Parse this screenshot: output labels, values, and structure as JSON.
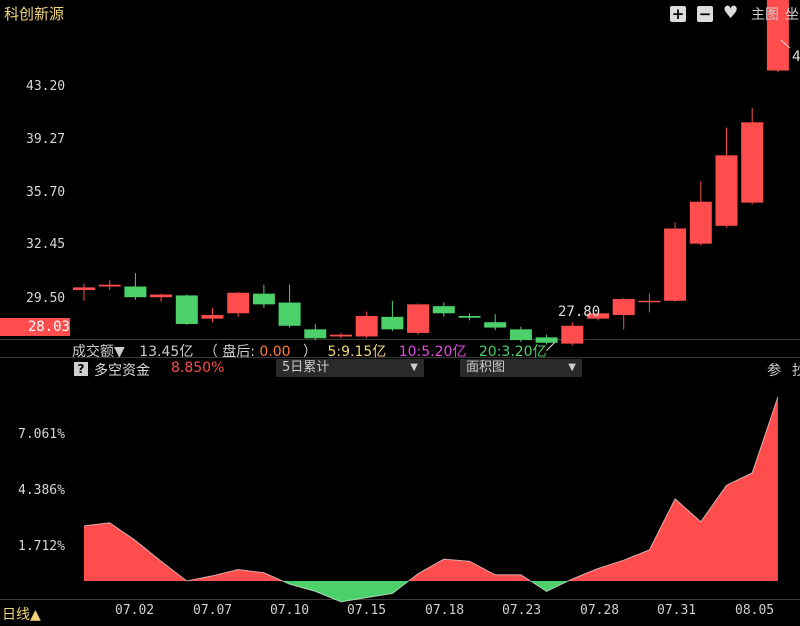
{
  "header": {
    "title": "科创新源",
    "add_icon": "plus-icon",
    "minus_icon": "minus-icon",
    "heart_icon": "heart-icon",
    "main_label": "主图",
    "coord_label": "坐"
  },
  "price_axis": {
    "labels": [
      "43.20",
      "39.27",
      "35.70",
      "32.45",
      "29.50"
    ]
  },
  "current_price": "28.03",
  "annotations": {
    "low_label": "27.80",
    "high_label": "4"
  },
  "volume_row": {
    "label": "成交额▼",
    "value": "13.45亿",
    "paren_open": "（",
    "after_label": "盘后:",
    "after_value": "0.00",
    "paren_close": "）",
    "ma5": "5:9.15亿",
    "ma10": "10:5.20亿",
    "ma20": "20:3.20亿"
  },
  "indicator_row": {
    "help_icon": "?",
    "name": "多空资金",
    "value": "8.850%",
    "period_select": "5日累计",
    "chart_select": "面积图",
    "ref_label": "参",
    "extra_label": "抄"
  },
  "indicator_axis": {
    "labels": [
      "7.061%",
      "4.386%",
      "1.712%"
    ]
  },
  "period_label": "日线▲",
  "x_axis": {
    "labels": [
      "07.02",
      "07.07",
      "07.10",
      "07.15",
      "07.18",
      "07.23",
      "07.28",
      "07.31",
      "08.05"
    ]
  },
  "colors": {
    "up": "#ff4c4c",
    "down": "#4cd16a",
    "accent": "#f0d37a",
    "bg": "#000000"
  },
  "chart_data": [
    {
      "type": "candlestick",
      "y_axis_ticks": [
        29.5,
        32.45,
        35.7,
        39.27,
        43.2
      ],
      "candles": [
        {
          "o": 30.0,
          "c": 30.15,
          "h": 30.35,
          "l": 29.4
        },
        {
          "o": 30.2,
          "c": 30.3,
          "h": 30.55,
          "l": 30.0
        },
        {
          "o": 30.2,
          "c": 29.6,
          "h": 30.95,
          "l": 29.45
        },
        {
          "o": 29.6,
          "c": 29.75,
          "h": 29.8,
          "l": 29.35
        },
        {
          "o": 29.7,
          "c": 28.1,
          "h": 29.75,
          "l": 28.05
        },
        {
          "o": 28.4,
          "c": 28.6,
          "h": 29.0,
          "l": 28.2
        },
        {
          "o": 28.7,
          "c": 29.85,
          "h": 29.9,
          "l": 28.5
        },
        {
          "o": 29.8,
          "c": 29.2,
          "h": 30.3,
          "l": 29.0
        },
        {
          "o": 29.3,
          "c": 28.0,
          "h": 30.3,
          "l": 27.9
        },
        {
          "o": 27.8,
          "c": 27.3,
          "h": 28.1,
          "l": 27.2
        },
        {
          "o": 27.4,
          "c": 27.5,
          "h": 27.6,
          "l": 27.3
        },
        {
          "o": 27.4,
          "c": 28.55,
          "h": 28.8,
          "l": 27.3
        },
        {
          "o": 28.5,
          "c": 27.8,
          "h": 29.4,
          "l": 27.7
        },
        {
          "o": 27.6,
          "c": 29.2,
          "h": 29.25,
          "l": 27.5
        },
        {
          "o": 29.1,
          "c": 28.7,
          "h": 29.3,
          "l": 28.5
        },
        {
          "o": 28.55,
          "c": 28.45,
          "h": 28.7,
          "l": 28.3
        },
        {
          "o": 28.2,
          "c": 27.9,
          "h": 28.65,
          "l": 27.75
        },
        {
          "o": 27.8,
          "c": 27.2,
          "h": 27.95,
          "l": 27.1
        },
        {
          "o": 27.35,
          "c": 27.05,
          "h": 27.5,
          "l": 26.95
        },
        {
          "o": 27.0,
          "c": 28.0,
          "h": 28.2,
          "l": 26.9
        },
        {
          "o": 28.4,
          "c": 28.7,
          "h": 28.8,
          "l": 28.3
        },
        {
          "o": 28.6,
          "c": 29.5,
          "h": 29.55,
          "l": 27.8
        },
        {
          "o": 29.4,
          "c": 29.4,
          "h": 29.8,
          "l": 28.75
        },
        {
          "o": 29.4,
          "c": 33.45,
          "h": 33.8,
          "l": 29.35
        },
        {
          "o": 32.6,
          "c": 34.95,
          "h": 36.1,
          "l": 32.5
        },
        {
          "o": 33.6,
          "c": 37.55,
          "h": 39.1,
          "l": 33.5
        },
        {
          "o": 34.9,
          "c": 39.4,
          "h": 40.2,
          "l": 34.8
        },
        {
          "o": 42.3,
          "c": 47.5,
          "h": 47.6,
          "l": 42.2
        }
      ]
    },
    {
      "type": "area",
      "title": "多空资金",
      "y_axis_ticks": [
        1.712,
        4.386,
        7.061
      ],
      "x_labels": [
        "07.02",
        "07.07",
        "07.10",
        "07.15",
        "07.18",
        "07.23",
        "07.28",
        "07.31",
        "08.05"
      ],
      "values": [
        2.65,
        2.8,
        1.95,
        0.95,
        0.0,
        0.25,
        0.55,
        0.4,
        -0.15,
        -0.5,
        -1.0,
        -0.8,
        -0.6,
        0.35,
        1.05,
        0.95,
        0.3,
        0.3,
        -0.5,
        0.1,
        0.6,
        1.0,
        1.5,
        3.95,
        2.85,
        4.6,
        5.2,
        8.85
      ]
    }
  ]
}
